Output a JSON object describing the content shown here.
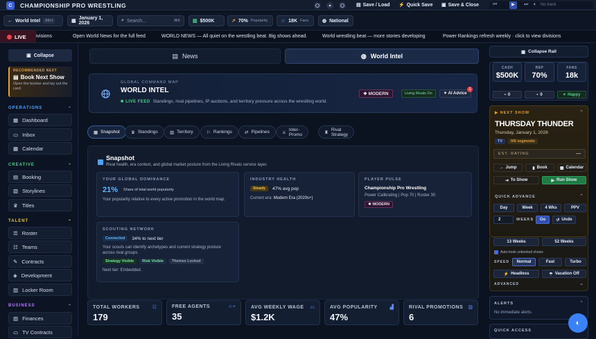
{
  "app": {
    "logo_letter": "C",
    "title": "CHAMPIONSHIP PRO WRESTLING"
  },
  "topbar": {
    "save_load": "Save / Load",
    "quick_save": "Quick Save",
    "save_close": "Save & Close",
    "track": "No track"
  },
  "bar2": {
    "world_intel": "World Intel",
    "alt_hint": "Alt+I",
    "date": "January 1, 2026",
    "search_placeholder": "Search...",
    "search_hint": "⌘K",
    "cash": "$500K",
    "popularity": "70%",
    "popularity_label": "Popularity",
    "fans": "18K",
    "fans_label": "Fans",
    "era": "National"
  },
  "ticker": {
    "live": "LIVE",
    "items": [
      "ivisions",
      "Open World News for the full feed",
      "WORLD NEWS — All quiet on the wrestling beat. Big shows ahead.",
      "World wrestling beat — more stories developing",
      "Power Rankings refresh weekly · click to view divisions"
    ]
  },
  "sidebar": {
    "collapse": "Collapse",
    "rec_label": "RECOMMENDED NEXT",
    "rec_title": "Book Next Show",
    "rec_desc": "Open the booker and lay out the card.",
    "sections": {
      "operations": "OPERATIONS",
      "creative": "CREATIVE",
      "talent": "TALENT",
      "business": "BUSINESS"
    },
    "items": {
      "dashboard": "Dashboard",
      "inbox": "Inbox",
      "calendar": "Calendar",
      "booking": "Booking",
      "storylines": "Storylines",
      "titles": "Titles",
      "roster": "Roster",
      "teams": "Teams",
      "contracts": "Contracts",
      "development": "Development",
      "locker_room": "Locker Room",
      "finances": "Finances",
      "tv_contracts": "TV Contracts"
    }
  },
  "main": {
    "tabs": {
      "news": "News",
      "world_intel": "World Intel"
    },
    "hero": {
      "eyebrow": "GLOBAL COMMAND MAP",
      "title": "WORLD INTEL",
      "live_feed": "LIVE FEED",
      "desc": "Standings, rival pipelines, IP auctions, and territory pressure across the wrestling world.",
      "modern": "MODERN",
      "rivals": "Living Rivals On",
      "advice": "AI Advice",
      "advice_count": "1"
    },
    "subtabs": [
      "Snapshot",
      "Standings",
      "Territory",
      "Rankings",
      "Pipelines",
      "Inter-Promo",
      "Rival Strategy"
    ],
    "snapshot": {
      "title": "Snapshot",
      "desc": "Rival health, era context, and global market posture from the Living Rivals service layer.",
      "dominance": {
        "title": "YOUR GLOBAL DOMINANCE",
        "value": "21%",
        "value_label": "Share of total world popularity",
        "desc": "Your popularity relative to every active promotion in the world map."
      },
      "industry": {
        "title": "INDUSTRY HEALTH",
        "tag": "Steady",
        "value": "47% avg pop",
        "era_label": "Current era:",
        "era_value": "Modern Era (2020s+)"
      },
      "pulse": {
        "title": "PLAYER PULSE",
        "name": "Championship Pro Wrestling",
        "meta": "Power Calibrating | Pop 70 | Roster 30",
        "tag": "MODERN"
      },
      "scouting": {
        "title": "SCOUTING NETWORK",
        "tag": "Connected",
        "value": "34% to next tier",
        "desc": "Your scouts can identify archetypes and current strategy posture across rival groups.",
        "chips": [
          "Strategy Visible",
          "Risk Visible",
          "Themes Locked"
        ],
        "next": "Next tier: Embedded."
      }
    },
    "stats": [
      {
        "label": "TOTAL WORKERS",
        "value": "179"
      },
      {
        "label": "FREE AGENTS",
        "value": "35"
      },
      {
        "label": "AVG WEEKLY WAGE",
        "value": "$1.2K"
      },
      {
        "label": "AVG POPULARITY",
        "value": "47%"
      },
      {
        "label": "RIVAL PROMOTIONS",
        "value": "6"
      }
    ]
  },
  "rail": {
    "collapse": "Collapse Rail",
    "cash_label": "CASH",
    "cash": "$500K",
    "cash_delta": "0",
    "rep_label": "REP",
    "rep": "70%",
    "rep_delta": "0",
    "fans_label": "FANS",
    "fans": "18k",
    "mood": "Happy",
    "next_show_label": "NEXT SHOW",
    "show_name": "THURSDAY THUNDER",
    "show_date": "Thursday, January 1, 2026",
    "show_type": "TV",
    "segments": "0/6 segments",
    "est_rating": "EST. RATING",
    "est_value": "—",
    "jump": "Jump",
    "book": "Book",
    "calendar": "Calendar",
    "to_show": "To Show",
    "run_show": "Run Show",
    "quick_advance": "QUICK ADVANCE",
    "day": "Day",
    "week": "Week",
    "four_wks": "4 Wks",
    "ppv": "PPV",
    "weeks_value": "2",
    "weeks_label": "WEEKS",
    "go": "Go",
    "undo": "Undo",
    "thirteen": "13 Weeks",
    "fifty_two": "52 Weeks",
    "autobook": "Auto-book unbooked shows",
    "speed_label": "SPEED",
    "normal": "Normal",
    "fast": "Fast",
    "turbo": "Turbo",
    "headless": "Headless",
    "vacation": "Vacation Off",
    "advanced": "ADVANCED",
    "alerts": "ALERTS",
    "no_alerts": "No immediate alerts.",
    "quick_access": "QUICK ACCESS"
  },
  "colors": {
    "accent": "#3b5fd8",
    "live": "#e8454f",
    "green": "#4bd18a",
    "gold": "#e4a13a"
  }
}
